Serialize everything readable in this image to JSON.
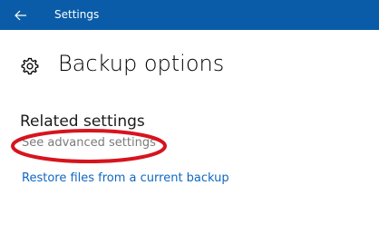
{
  "window": {
    "app_title": "Settings",
    "back_icon": "back-arrow-icon",
    "titlebar_color": "#0a5ca8"
  },
  "page": {
    "title": "Backup options",
    "title_icon": "gear-icon"
  },
  "related_settings": {
    "title": "Related settings",
    "links": [
      "See advanced settings",
      "Restore files from a current backup"
    ]
  },
  "annotation": {
    "type": "ellipse",
    "color": "#d7141e",
    "target": "See advanced settings"
  },
  "colors": {
    "link": "#1067c2",
    "muted_link": "#7b7b7b"
  }
}
